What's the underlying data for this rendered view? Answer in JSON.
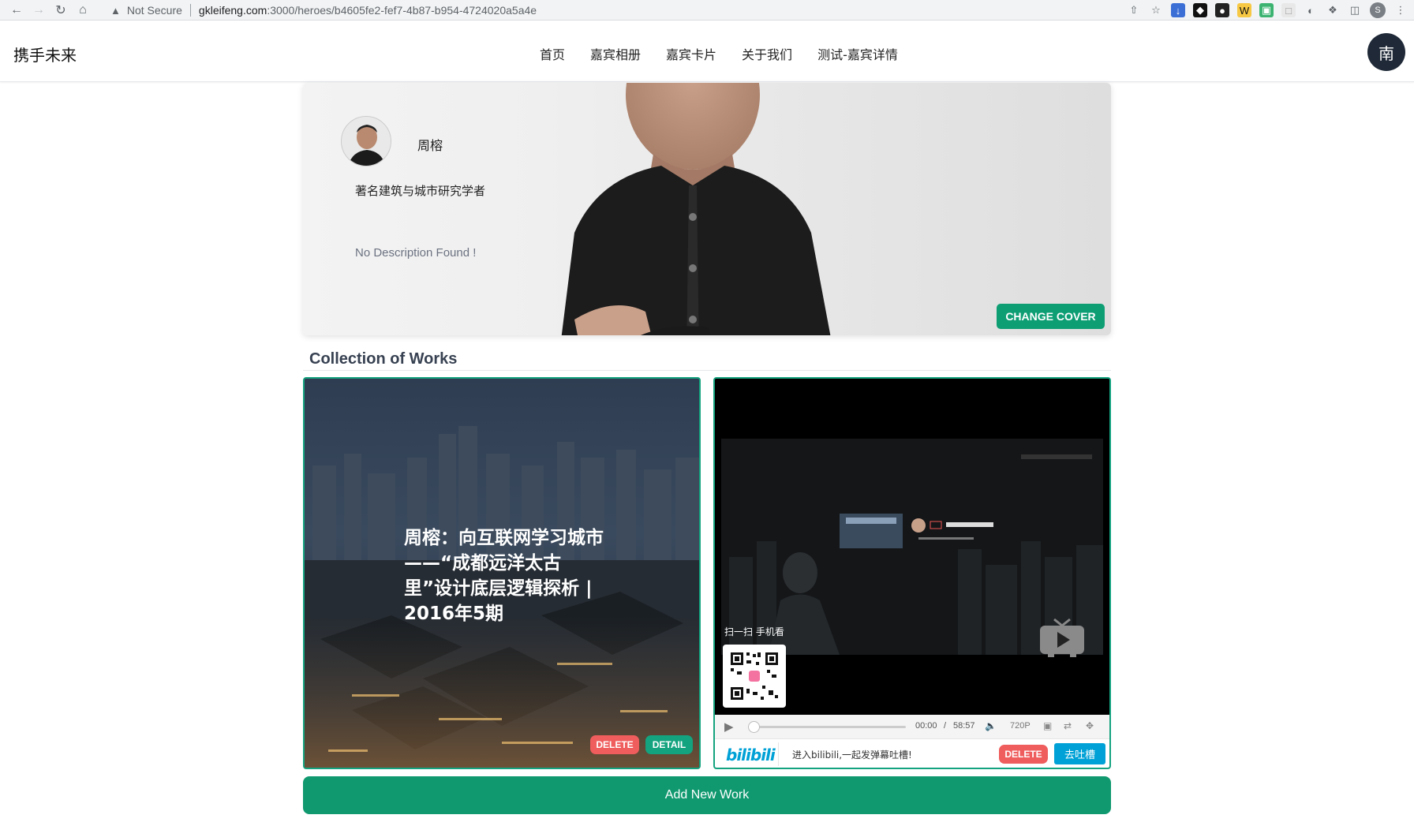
{
  "browser": {
    "security_label": "Not Secure",
    "url_host": "gkleifeng.com",
    "url_path": ":3000/heroes/b4605fe2-fef7-4b87-b954-4724020a5a4e",
    "profile_initial": "S",
    "icons": [
      "back-icon",
      "forward-icon",
      "reload-icon",
      "home-icon",
      "warning-icon",
      "share-icon",
      "bookmark-star-icon",
      "extensions-icon",
      "side-panel-icon"
    ]
  },
  "header": {
    "brand": "携手未来",
    "nav": [
      "首页",
      "嘉宾相册",
      "嘉宾卡片",
      "关于我们",
      "测试-嘉宾详情"
    ],
    "user_initial": "南"
  },
  "hero": {
    "name": "周榕",
    "title": "著名建筑与城市研究学者",
    "description": "No Description Found !",
    "change_cover_label": "CHANGE COVER"
  },
  "collection": {
    "heading": "Collection of Works",
    "works": [
      {
        "type": "article",
        "title": "周榕：向互联网学习城市——“成都远洋太古里”设计底层逻辑探析 | 2016年5期",
        "delete_label": "DELETE",
        "detail_label": "DETAIL"
      },
      {
        "type": "video",
        "scan_label": "扫一扫 手机看",
        "time_current": "00:00",
        "time_separator": "/",
        "time_total": "58:57",
        "quality": "720P",
        "danmu_prompt": "进入bilibili,一起发弹幕吐槽!",
        "bilibili_logo": "bilibili",
        "delete_label": "DELETE",
        "tucao_label": "去吐槽",
        "progress": 0
      }
    ],
    "add_label": "Add New Work"
  },
  "colors": {
    "primary_green": "#10996f",
    "danger_red": "#ef5d5d",
    "bilibili_blue": "#00a1d6",
    "avatar_dark": "#1f2937"
  }
}
